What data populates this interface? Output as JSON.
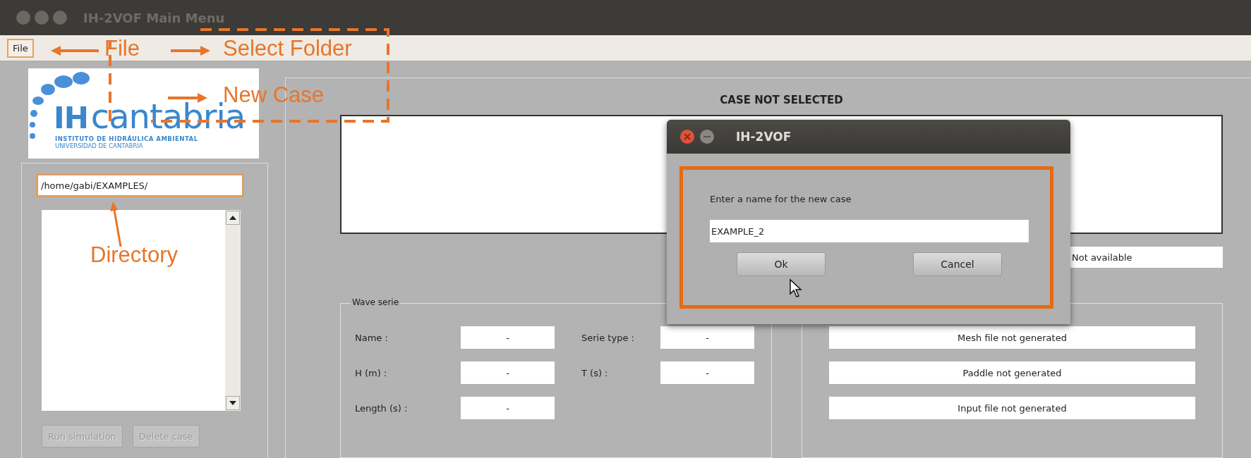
{
  "window": {
    "title": "IH-2VOF Main Menu"
  },
  "menu": [
    {
      "label": "File",
      "selected": true
    }
  ],
  "logo": {
    "name_bold": "IH",
    "name": "cantabria",
    "subtitle": "INSTITUTO DE HIDRÁULICA AMBIENTAL",
    "subtitle_2": "UNIVERSIDAD DE CANTABRIA"
  },
  "sidebar": {
    "directory": "/home/gabi/EXAMPLES/",
    "buttons": [
      {
        "label": "Run simulation",
        "disabled": true
      },
      {
        "label": "Delete case",
        "disabled": true
      }
    ]
  },
  "case": {
    "title": "CASE NOT SELECTED",
    "status": "Not available"
  },
  "wave_serie": {
    "title": "Wave serie",
    "fields": [
      {
        "label": "Name :",
        "value": "-"
      },
      {
        "label": "Serie type :",
        "value": "-"
      },
      {
        "label": "H (m) :",
        "value": "-"
      },
      {
        "label": "T (s) :",
        "value": "-"
      },
      {
        "label": "Length (s) :",
        "value": "-"
      }
    ]
  },
  "files": [
    "Mesh file not generated",
    "Paddle not generated",
    "Input file not generated"
  ],
  "dialog": {
    "title": "IH-2VOF",
    "prompt": "Enter a name for the new case",
    "value": "EXAMPLE_2",
    "buttons": [
      "Ok",
      "Cancel"
    ]
  },
  "annotations": [
    {
      "text": "File"
    },
    {
      "text": "Select Folder"
    },
    {
      "text": "New Case"
    },
    {
      "text": "Directory"
    }
  ]
}
